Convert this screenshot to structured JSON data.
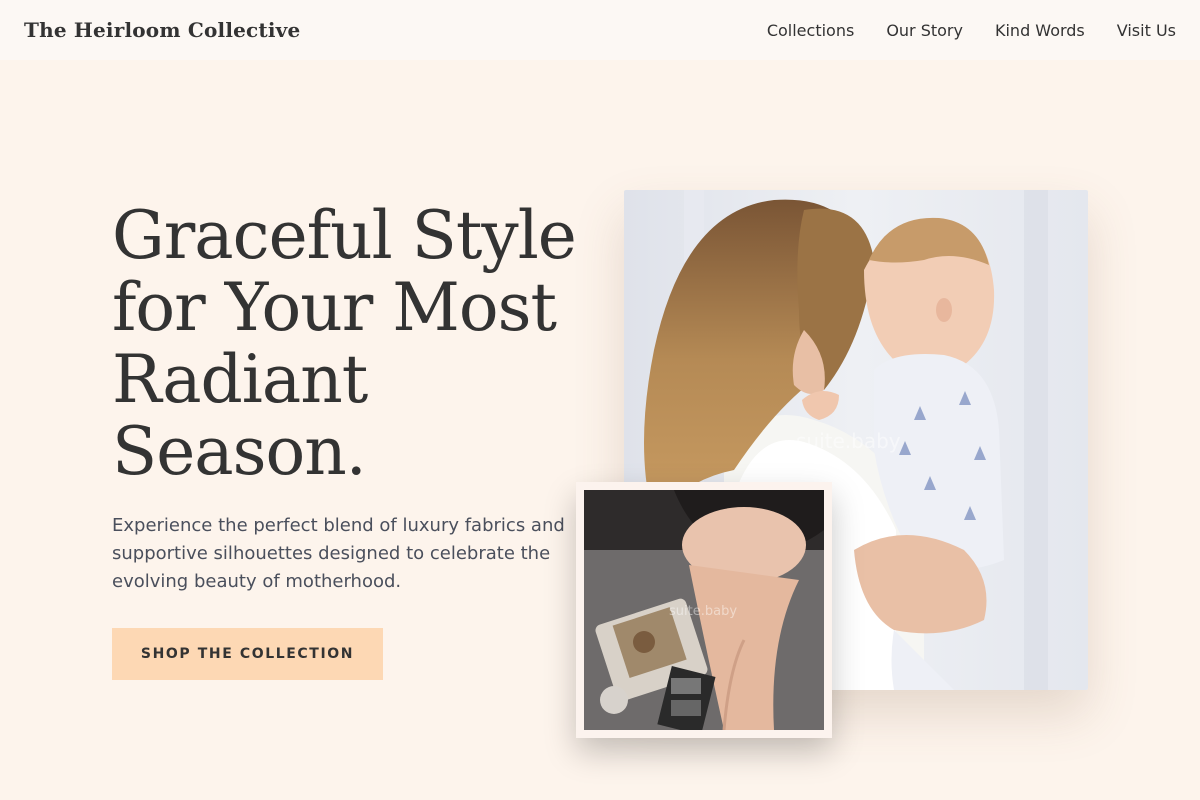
{
  "brand": {
    "name": "The Heirloom Collective"
  },
  "nav": {
    "items": [
      {
        "label": "Collections"
      },
      {
        "label": "Our Story"
      },
      {
        "label": "Kind Words"
      },
      {
        "label": "Visit Us"
      }
    ]
  },
  "hero": {
    "headline_lines": [
      "Graceful Style",
      "for Your Most",
      "Radiant",
      "Season."
    ],
    "subtext": "Experience the perfect blend of luxury fabrics and supportive silhouettes designed to celebrate the evolving beauty of motherhood.",
    "cta_label": "SHOP THE COLLECTION"
  },
  "images": {
    "main_watermark": "suite.baby",
    "small_watermark": "suite.baby"
  },
  "colors": {
    "page_background": "#fdf4ec",
    "nav_background": "#fcf8f4",
    "cta_background": "#fdd8b4",
    "text_dark": "#333333",
    "text_muted": "#4a4f5c"
  }
}
